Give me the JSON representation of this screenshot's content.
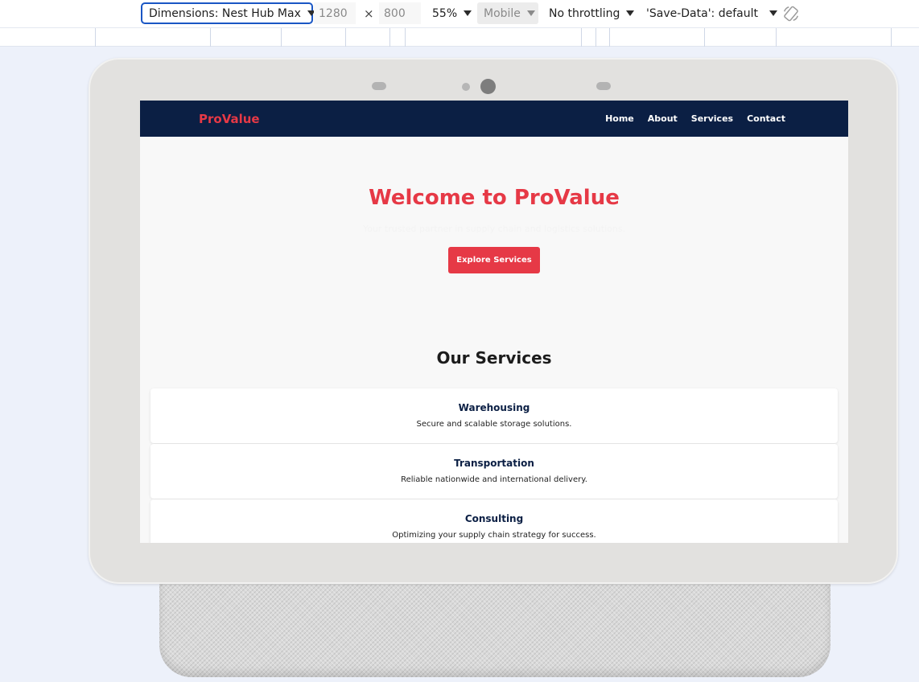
{
  "devtools": {
    "dimensions_label": "Dimensions: Nest Hub Max",
    "width_value": "1280",
    "times_symbol": "×",
    "height_value": "800",
    "zoom": "55%",
    "mobile": "Mobile",
    "throttling": "No throttling",
    "save_data": "'Save-Data': default"
  },
  "site": {
    "brand": "ProValue",
    "nav": [
      "Home",
      "About",
      "Services",
      "Contact"
    ],
    "hero": {
      "title": "Welcome to ProValue",
      "subtitle": "Your trusted partner in supply chain and logistics solutions.",
      "cta": "Explore Services"
    },
    "services": {
      "title": "Our Services",
      "items": [
        {
          "title": "Warehousing",
          "desc": "Secure and scalable storage solutions."
        },
        {
          "title": "Transportation",
          "desc": "Reliable nationwide and international delivery."
        },
        {
          "title": "Consulting",
          "desc": "Optimizing your supply chain strategy for success."
        }
      ]
    }
  },
  "colors": {
    "navbar": "#0b1f44",
    "accent": "#e63946",
    "focus": "#1a56c4"
  }
}
